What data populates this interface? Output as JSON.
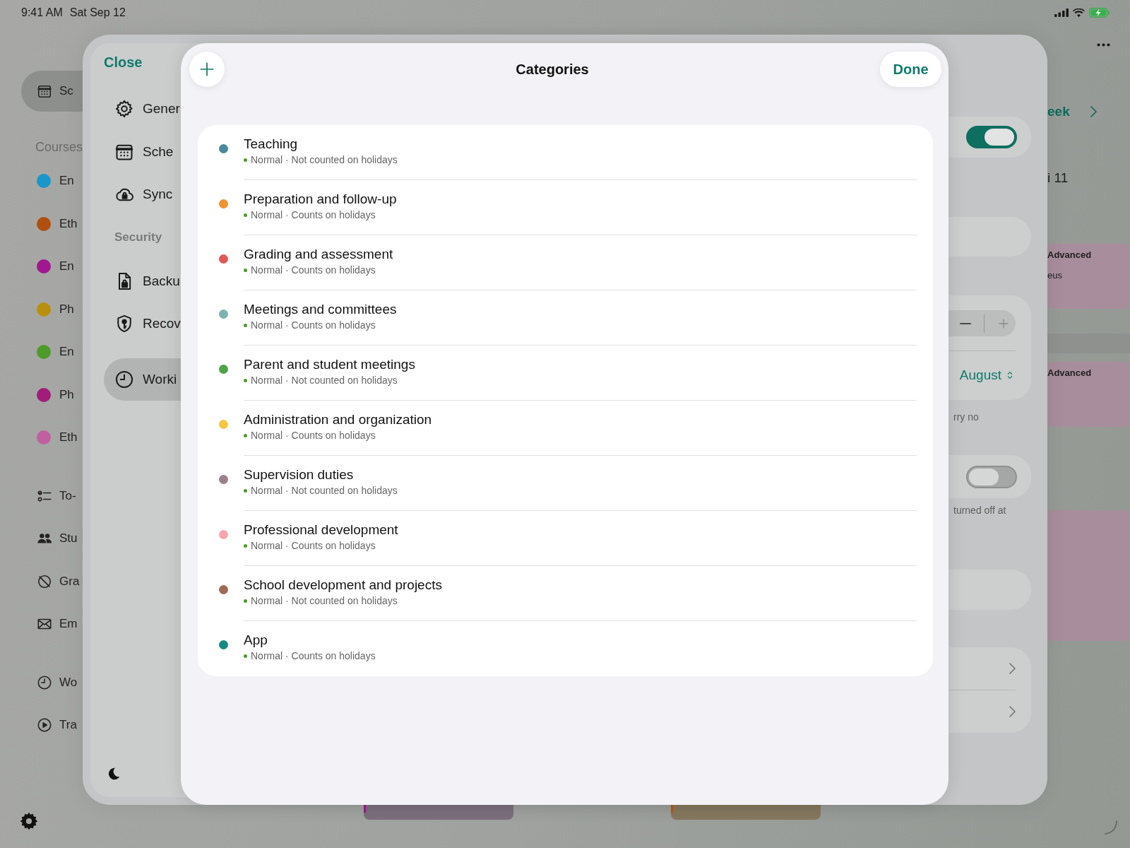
{
  "status_bar": {
    "time": "9:41 AM",
    "date": "Sat Sep 12"
  },
  "background": {
    "sidebar": {
      "groups": [
        {
          "items": [
            {
              "label": "Sc",
              "selected": true
            }
          ]
        },
        {
          "header": "Courses",
          "items": [
            {
              "label": "En",
              "color": "#1b96c8"
            },
            {
              "label": "Eth",
              "color": "#b0500f"
            },
            {
              "label": "En",
              "color": "#a0188f"
            },
            {
              "label": "Ph",
              "color": "#b8900f"
            },
            {
              "label": "En",
              "color": "#4e9a2a"
            },
            {
              "label": "Ph",
              "color": "#a01d7a"
            },
            {
              "label": "Eth",
              "color": "#c060a0"
            }
          ]
        },
        {
          "items": [
            {
              "label": "To-",
              "selected": false
            },
            {
              "label": "Stu",
              "selected": false
            },
            {
              "label": "Gra",
              "selected": false
            },
            {
              "label": "Em",
              "selected": false
            }
          ]
        },
        {
          "items": [
            {
              "label": "Wo",
              "selected": false
            },
            {
              "label": "Tra",
              "selected": false
            }
          ]
        }
      ]
    },
    "week_button": "eek",
    "day_heading": "i 11",
    "events": [
      {
        "kind": "event",
        "title": "Advanced",
        "detail": "eus"
      },
      {
        "kind": "allday"
      },
      {
        "kind": "event",
        "title": "Advanced"
      },
      {
        "kind": "event"
      }
    ],
    "bottom_events": [
      {
        "color": "#a0188f"
      },
      {
        "color": "#c0550f"
      }
    ]
  },
  "settings": {
    "close": "Close",
    "groups": [
      {
        "items": [
          {
            "label": "Gener",
            "selected": false
          },
          {
            "label": "Sche",
            "selected": false
          },
          {
            "label": "Sync",
            "selected": false
          }
        ]
      },
      {
        "header": "Security",
        "items": [
          {
            "label": "Backu",
            "selected": false
          },
          {
            "label": "Recov",
            "selected": false
          }
        ]
      },
      {
        "items": [
          {
            "label": "Worki",
            "selected": true
          }
        ]
      }
    ],
    "detail": [
      {
        "kind": "toggle",
        "on": true
      },
      {
        "kind": "field"
      },
      {
        "kind": "stepper",
        "picker": "August"
      },
      {
        "kind": "note",
        "text": "rry no"
      },
      {
        "kind": "toggle",
        "on": false
      },
      {
        "kind": "note",
        "text": "turned off at"
      },
      {
        "kind": "field"
      },
      {
        "kind": "links"
      }
    ]
  },
  "categories": {
    "title": "Categories",
    "done": "Done",
    "items": [
      {
        "name": "Teaching",
        "detail": "Normal · Not counted on holidays",
        "color": "#4a8a9a"
      },
      {
        "name": "Preparation and follow-up",
        "detail": "Normal · Counts on holidays",
        "color": "#f39232"
      },
      {
        "name": "Grading and assessment",
        "detail": "Normal · Counts on holidays",
        "color": "#e05858"
      },
      {
        "name": "Meetings and committees",
        "detail": "Normal · Counts on holidays",
        "color": "#7fb3ae"
      },
      {
        "name": "Parent and student meetings",
        "detail": "Normal · Not counted on holidays",
        "color": "#4ea24a"
      },
      {
        "name": "Administration and organization",
        "detail": "Normal · Counts on holidays",
        "color": "#f5c842"
      },
      {
        "name": "Supervision duties",
        "detail": "Normal · Not counted on holidays",
        "color": "#9a7f8f"
      },
      {
        "name": "Professional development",
        "detail": "Normal · Counts on holidays",
        "color": "#f7a6b0"
      },
      {
        "name": "School development and projects",
        "detail": "Normal · Not counted on holidays",
        "color": "#a06a5a"
      },
      {
        "name": "App",
        "detail": "Normal · Counts on holidays",
        "color": "#1a8a80"
      }
    ]
  }
}
